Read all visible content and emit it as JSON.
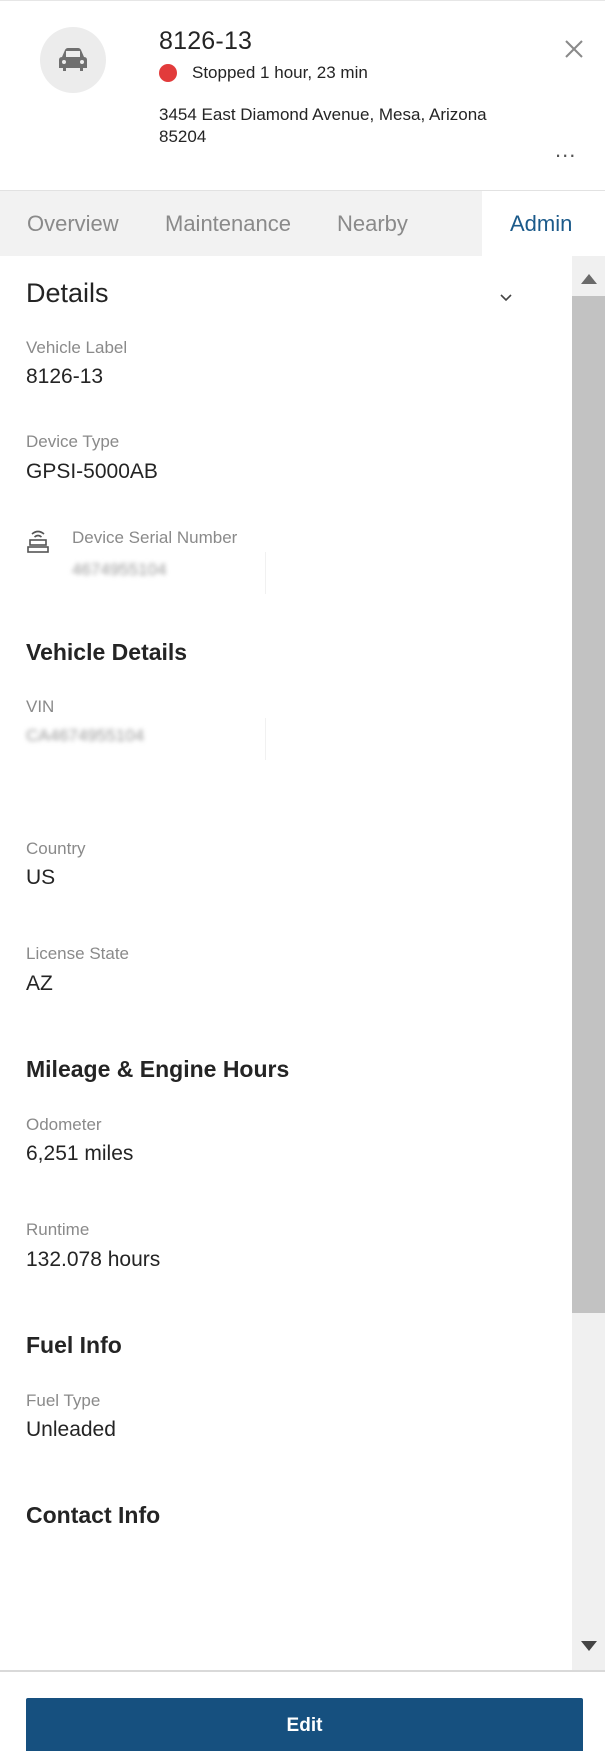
{
  "header": {
    "vehicle_name": "8126-13",
    "status_text": "Stopped 1 hour, 23 min",
    "status_color": "#e23b3b",
    "address_line1": "3454 East Diamond Avenue, Mesa, Arizona",
    "address_line2": "85204",
    "avatar_icon": "car-icon",
    "close_icon": "close-icon",
    "more_label": "..."
  },
  "tabs": [
    {
      "label": "Overview",
      "active": false
    },
    {
      "label": "Maintenance",
      "active": false
    },
    {
      "label": "Nearby",
      "active": false
    },
    {
      "label": "Admin",
      "active": true
    }
  ],
  "details": {
    "title": "Details",
    "vehicle_label_label": "Vehicle Label",
    "vehicle_label_value": "8126-13",
    "device_type_label": "Device Type",
    "device_type_value": "GPSI-5000AB",
    "device_serial_label": "Device Serial Number",
    "device_serial_value": "4674955104"
  },
  "vehicle_details": {
    "title": "Vehicle Details",
    "vin_label": "VIN",
    "vin_value": "CA4674955104",
    "country_label": "Country",
    "country_value": "US",
    "license_state_label": "License State",
    "license_state_value": "AZ"
  },
  "mileage": {
    "title": "Mileage & Engine Hours",
    "odometer_label": "Odometer",
    "odometer_value": "6,251 miles",
    "runtime_label": "Runtime",
    "runtime_value": "132.078 hours"
  },
  "fuel": {
    "title": "Fuel Info",
    "fuel_type_label": "Fuel Type",
    "fuel_type_value": "Unleaded"
  },
  "contact": {
    "title": "Contact Info"
  },
  "footer": {
    "edit_label": "Edit",
    "accent_color": "#16507f"
  }
}
